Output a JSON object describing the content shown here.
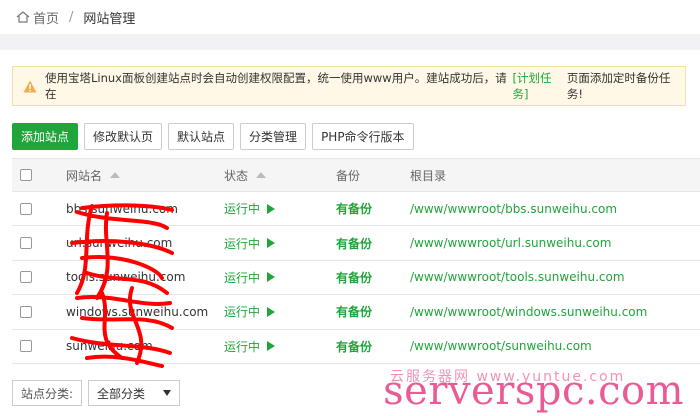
{
  "breadcrumb": {
    "home": "首页",
    "separator": "/",
    "current": "网站管理"
  },
  "notice": {
    "text_before": "使用宝塔Linux面板创建站点时会自动创建权限配置，统一使用www用户。建站成功后，请在",
    "link": "[计划任务]",
    "text_after": "页面添加定时备份任务!"
  },
  "toolbar": {
    "add_site": "添加站点",
    "modify_default_page": "修改默认页",
    "default_site": "默认站点",
    "category_manage": "分类管理",
    "php_cli_version": "PHP命令行版本"
  },
  "table": {
    "headers": {
      "name": "网站名",
      "status": "状态",
      "backup": "备份",
      "root": "根目录"
    },
    "rows": [
      {
        "name": "bbs.sunweihu.com",
        "status": "运行中",
        "backup": "有备份",
        "root": "/www/wwwroot/bbs.sunweihu.com"
      },
      {
        "name": "url.sunweihu.com",
        "status": "运行中",
        "backup": "有备份",
        "root": "/www/wwwroot/url.sunweihu.com"
      },
      {
        "name": "tools.sunweihu.com",
        "status": "运行中",
        "backup": "有备份",
        "root": "/www/wwwroot/tools.sunweihu.com"
      },
      {
        "name": "windows.sunweihu.com",
        "status": "运行中",
        "backup": "有备份",
        "root": "/www/wwwroot/windows.sunweihu.com"
      },
      {
        "name": "sunweihu.com",
        "status": "运行中",
        "backup": "有备份",
        "root": "/www/wwwroot/sunweihu.com"
      }
    ]
  },
  "footer": {
    "category_label": "站点分类:",
    "category_value": "全部分类"
  },
  "watermark": {
    "main": "serverspc.com",
    "top": "云服务器网 www.yuntue.com"
  },
  "colors": {
    "accent": "#20a53a",
    "warning": "#f0ad4e",
    "scribble": "#ff0000",
    "watermark": "#e84a8a"
  }
}
